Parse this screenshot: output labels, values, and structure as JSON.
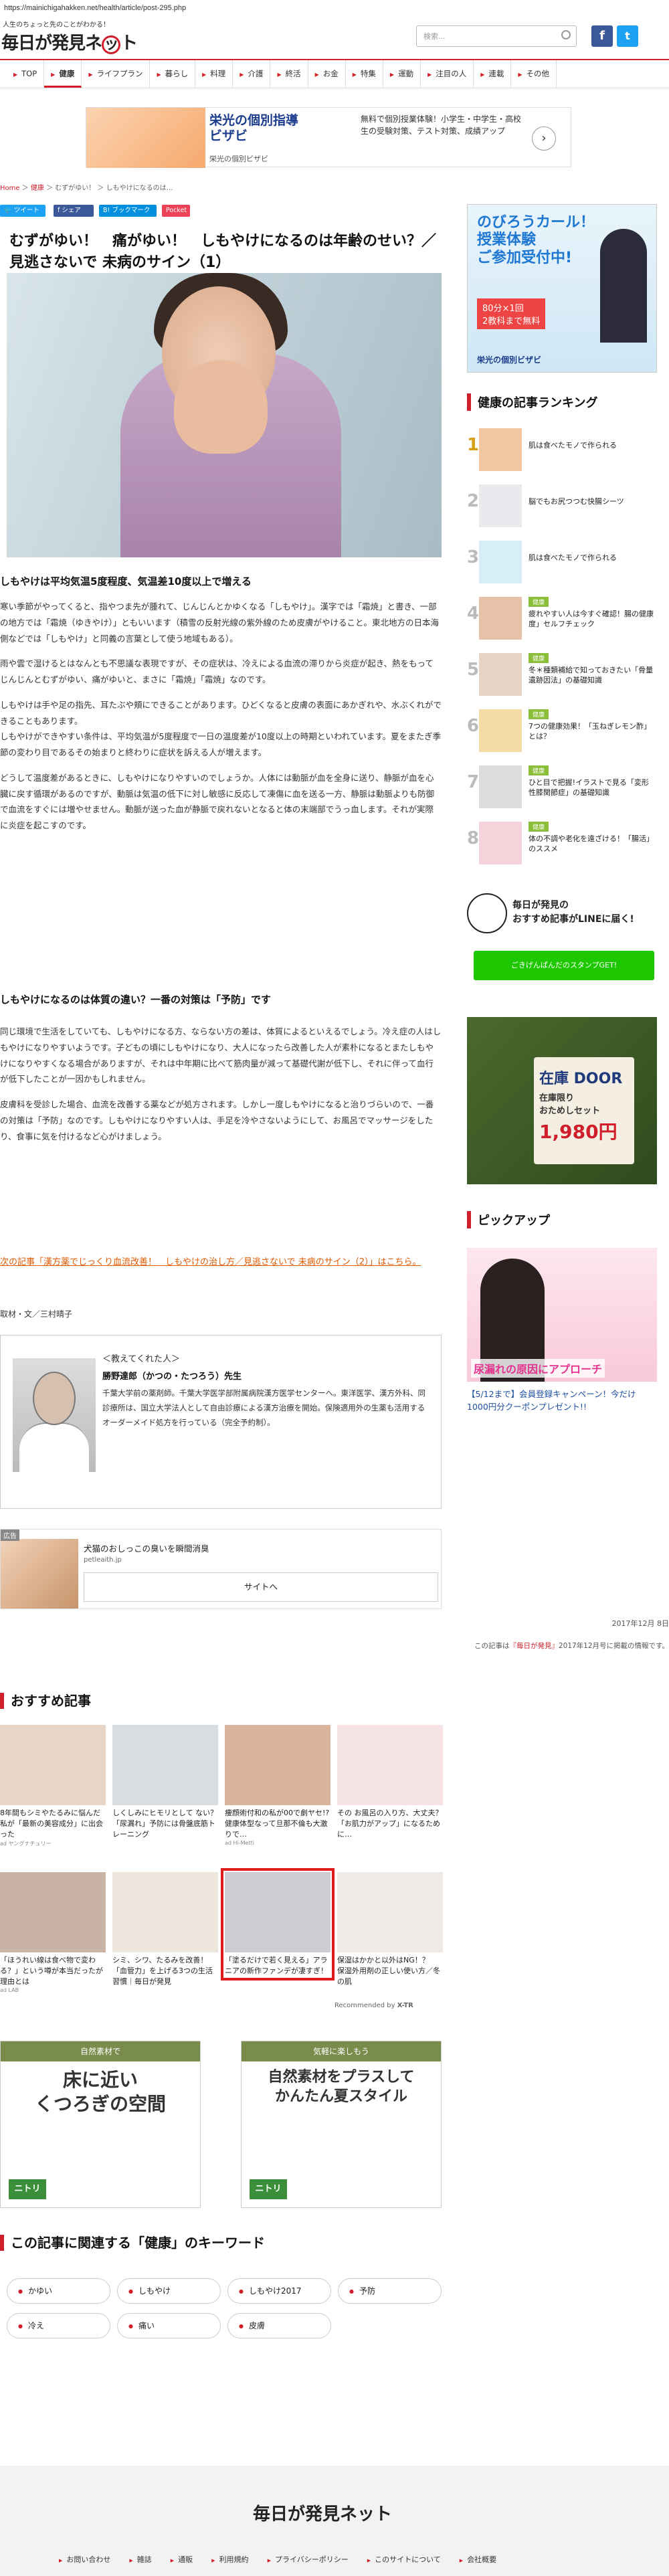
{
  "browser": {
    "url": "https://mainichigahakken.net/health/article/post-295.php"
  },
  "header": {
    "tagline": "人生のちょっと先のことがわかる！",
    "logo_a": "毎日が発見ネ",
    "logo_b": "ト",
    "logo_ring": "ッ",
    "search_placeholder": "検索...",
    "fb": "f",
    "tw": "t"
  },
  "nav": [
    "TOP",
    "健康",
    "ライフプラン",
    "暮らし",
    "料理",
    "介護",
    "終活",
    "お金",
    "特集",
    "運動",
    "注目の人",
    "連載",
    "その他"
  ],
  "top_ad": {
    "title": "栄光の個別指導\nビザビ",
    "brand": "栄光の個別ビザビ",
    "desc": "無料で個別授業体験！小学生・中学生・高校生の受験対策、テスト対策、成績アップ"
  },
  "breadcrumb": {
    "home": "Home",
    "cat": "健康",
    "sub": "むずがゆい！",
    "cur": "しもやけになるのは…"
  },
  "share": {
    "tw": "ツイート",
    "fb": "シェア",
    "hb": "ブックマーク",
    "po": "Pocket"
  },
  "article": {
    "title": "むずがゆい！　痛がゆい！　しもやけになるのは年齢のせい？／見逃さないで 未病のサイン（1）",
    "h1": "しもやけは平均気温5度程度、気温差10度以上で増える",
    "p1": "寒い季節がやってくると、指やつま先が腫れて、じんじんとかゆくなる「しもやけ」。漢字では「霜焼」と書き、一部の地方では「霜焼（ゆきやけ）」ともいいます（積雪の反射光線の紫外線のため皮膚がやけること。東北地方の日本海側などでは「しもやけ」と同義の言葉として使う地域もある）。",
    "p2": "雨や雲で湿けるとはなんとも不思議な表現ですが、その症状は、冷えによる血流の滞りから炎症が起き、熱をもってじんじんとむずがゆい、痛がゆいと、まさに「霜焼」「霜焼」なのです。",
    "p3": "しもやけは手や足の指先、耳たぶや頬にできることがあります。ひどくなると皮膚の表面にあかぎれや、水ぶくれができることもあります。\nしもやけができやすい条件は、平均気温が5度程度で一日の温度差が10度以上の時期といわれています。夏をまたぎ季節の変わり目であるその始まりと終わりに症状を訴える人が増えます。",
    "p4": "どうして温度差があるときに、しもやけになりやすいのでしょうか。人体には動脈が血を全身に送り、静脈が血を心臓に戻す循環があるのですが、動脈は気温の低下に対し敏感に反応して凍傷に血を送る一方、静脈は動脈よりも防御で血流をすぐには増やせません。動脈が送った血が静脈で戻れないとなると体の末端部でうっ血します。それが実際に炎症を起こすのです。",
    "h2": "しもやけになるのは体質の違い？一番の対策は「予防」です",
    "p5": "同じ環境で生活をしていても、しもやけになる方、ならない方の差は、体質によるといえるでしょう。冷え症の人はしもやけになりやすいようです。子どもの頃にしもやけになり、大人になったら改善した人が素朴になるとまたしもやけになりやすくなる場合がありますが、それは中年期に比べて筋肉量が減って基礎代謝が低下し、それに伴って血行が低下したことが一因かもしれません。",
    "p6": "皮膚科を受診した場合、血流を改善する薬などが処方されます。しかし一度しもやけになると治りづらいので、一番の対策は「予防」なのです。しもやけになりやすい人は、手足を冷やさないようにして、お風呂でマッサージをしたり、食事に気を付けるなど心がけましょう。",
    "next": "次の記事「漢方薬でじっくり血流改善！　しもやけの治し方／見逃さないで 未病のサイン（2）」はこちら。",
    "author": "取材・文／三村晴子",
    "date": "2017年12月 8日",
    "note_pre": "この記事は",
    "note_link": "『毎日が発見』",
    "note_post": "2017年12月号に掲載の情報です。"
  },
  "profile": {
    "label": "＜教えてくれた人＞",
    "name": "勝野達郎（かつの・たつろう）先生",
    "bio": "千葉大学前の薬剤師。千葉大学医学部附属病院漢方医学センターへ。東洋医学、漢方外科、同診療所は、国立大学法人として自由診療による漢方治療を開始。保険適用外の生薬も活用するオーダーメイド処方を行っている（完全予約制）。"
  },
  "inline_ad": {
    "badge": "広告",
    "title": "犬猫のおしっこの臭いを瞬間消臭",
    "src": "petleaith.jp",
    "btn": "サイトへ"
  },
  "recommend": {
    "title": "おすすめ記事",
    "by": "Recommended by",
    "items": [
      {
        "cap": "8年間もシミやたるみに悩んだ私が「最新の美容成分」に出会った",
        "src": "ad ヤングナチュリー"
      },
      {
        "cap": "しくしみにヒモリとして ない？「尿漏れ」予防には骨盤底筋トレーニング",
        "src": ""
      },
      {
        "cap": "痩顔術付和の私が00で劇ヤセ!?健康体型なって旦那不倫も大激りで…",
        "src": "ad Hi-Metti"
      },
      {
        "cap": "その お風呂の入り方、大丈夫？「お肌力がアップ」になるために…",
        "src": ""
      },
      {
        "cap": "「ほうれい線は食べ物で変わる？」という噂が本当だったが理由とは",
        "src": "ad LAB"
      },
      {
        "cap": "シミ、シワ、たるみを改善！「血管力」を上げる3つの生活習慣｜毎日が発見",
        "src": ""
      },
      {
        "cap": "「塗るだけで若く見える」アラニアの新作ファンデが凄すぎ！",
        "src": ""
      },
      {
        "cap": "保湿はかかと以外はNG！？　保湿外用剤の正しい使い方／冬の肌",
        "src": ""
      }
    ]
  },
  "banners": [
    {
      "top": "自然素材で",
      "big": "床に近い\nくつろぎの空間",
      "brand": "ニトリ"
    },
    {
      "top": "気軽に楽しもう",
      "big": "自然素材をプラスして\nかんたん夏スタイル",
      "brand": "ニトリ"
    }
  ],
  "keywords": {
    "title": "この記事に関連する「健康」のキーワード",
    "items": [
      "かゆい",
      "しもやけ",
      "しもやけ2017",
      "予防",
      "冷え",
      "痛い",
      "皮膚"
    ]
  },
  "side": {
    "ad": {
      "t1": "のびろうカール！\n授業体験\nご参加受付中!",
      "t2": "80分×1回\n2教科まで無料",
      "brand": "栄光の個別ビザビ"
    },
    "ranking_title": "健康の記事ランキング",
    "ranking": [
      {
        "tag": "",
        "cap": "肌は食べたモノで作られる"
      },
      {
        "tag": "",
        "cap": "脳でもお尻つつむ快腸シーツ"
      },
      {
        "tag": "",
        "cap": "肌は食べたモノで作られる"
      },
      {
        "tag": "健康",
        "cap": "疲れやすい人は今すぐ確認！腸の健康度」セルフチェック"
      },
      {
        "tag": "健康",
        "cap": "冬＊種類補給で知っておきたい「骨量遺跡因法」の基礎知識"
      },
      {
        "tag": "健康",
        "cap": "7つの健康効果！「玉ねぎレモン酢」とは？"
      },
      {
        "tag": "健康",
        "cap": "ひと目で把握!イラストで見る「変形性膝関節症」の基礎知識"
      },
      {
        "tag": "健康",
        "cap": "体の不調や老化を遠ざける！「腸活」のススメ"
      }
    ],
    "line": {
      "txt": "毎日が発見の\nおすすめ記事がLINEに届く!",
      "btn": "ごきげんぱんだのスタンプGET!"
    },
    "pr": {
      "p1": "在庫 DOOR",
      "p2": "在庫限り\nおためしセット",
      "p3": "1,980円"
    },
    "pickup_title": "ピックアップ",
    "pickup_img_a": "尿漏れの原因に",
    "pickup_img_b": "アプローチ",
    "pickup_cap": "【5/12まで】会員登録キャンペーン！今だけ1000円分クーポンプレゼント!!"
  },
  "footer": {
    "logo": "毎日が発見ネット",
    "links": [
      "お問い合わせ",
      "雑誌",
      "通販",
      "利用規約",
      "プライバシーポリシー",
      "このサイトについて",
      "会社概要"
    ]
  }
}
